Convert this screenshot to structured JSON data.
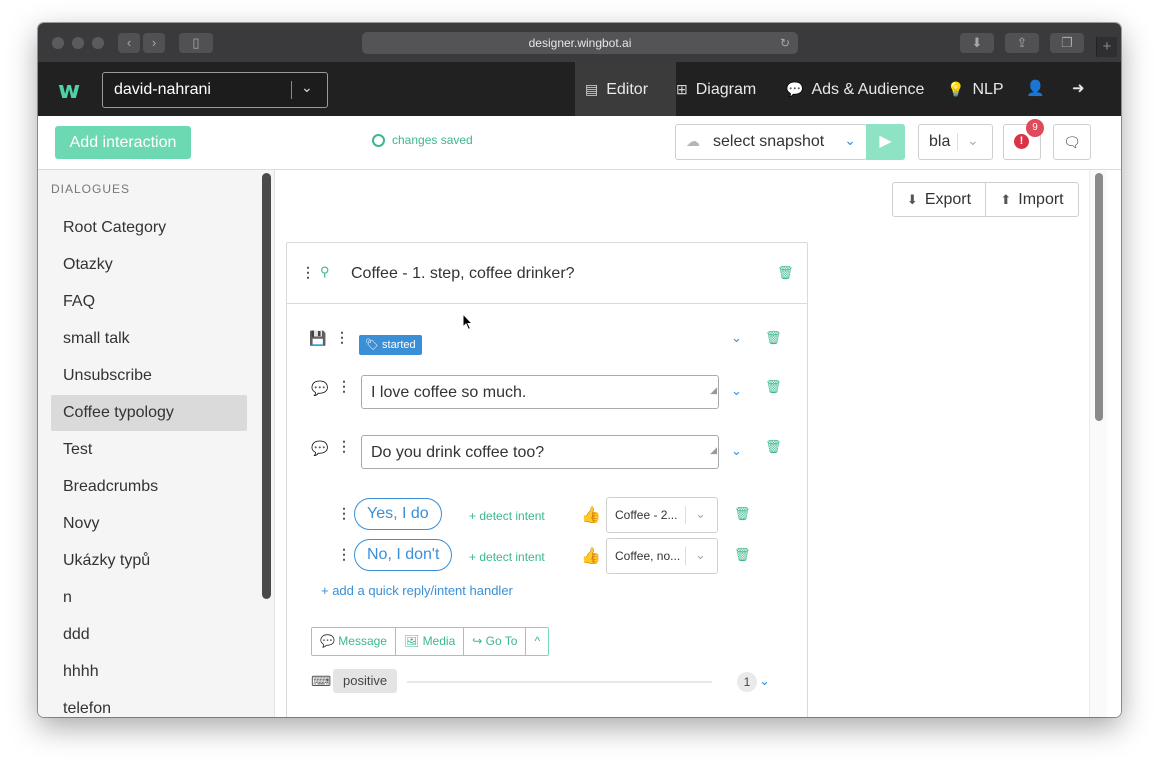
{
  "browser": {
    "url": "designer.wingbot.ai",
    "nav_back": "‹",
    "nav_forward": "›",
    "new_tab": "+"
  },
  "navbar": {
    "logo": "w",
    "bot_name": "david-nahrani",
    "items": [
      {
        "label": "Editor",
        "icon": "editor-icon"
      },
      {
        "label": "Diagram",
        "icon": "sitemap-icon"
      },
      {
        "label": "Ads & Audience",
        "icon": "comment-icon"
      },
      {
        "label": "NLP",
        "icon": "lightbulb-icon"
      }
    ]
  },
  "toolbar": {
    "add_interaction": "Add interaction",
    "status": "changes saved",
    "snapshot_placeholder": "select snapshot",
    "env_value": "bla",
    "alert_count": "9"
  },
  "sidebar": {
    "heading": "DIALOGUES",
    "items": [
      {
        "label": "Root Category"
      },
      {
        "label": "Otazky"
      },
      {
        "label": "FAQ"
      },
      {
        "label": "small talk"
      },
      {
        "label": "Unsubscribe"
      },
      {
        "label": "Coffee typology",
        "active": true
      },
      {
        "label": "Test"
      },
      {
        "label": "Breadcrumbs"
      },
      {
        "label": "Novy"
      },
      {
        "label": "Ukázky typů"
      },
      {
        "label": "n"
      },
      {
        "label": "ddd"
      },
      {
        "label": "hhhh"
      },
      {
        "label": "telefon"
      }
    ]
  },
  "main": {
    "export_label": "Export",
    "import_label": "Import",
    "interaction": {
      "title": "Coffee - 1. step, coffee drinker?",
      "tag": "started",
      "messages": [
        {
          "text": "I love coffee so much."
        },
        {
          "text": "Do you drink coffee too?"
        }
      ],
      "quick_replies": [
        {
          "label": "Yes, I do",
          "detect": "+ detect intent",
          "target": "Coffee - 2..."
        },
        {
          "label": "No, I don't",
          "detect": "+ detect intent",
          "target": "Coffee, no..."
        }
      ],
      "add_quick_reply": "+ add a quick reply/intent handler",
      "buttons": {
        "message": "Message",
        "media": "Media",
        "goto": "Go To",
        "more": "^"
      },
      "intent_pill": "positive",
      "intent_count": "1"
    }
  },
  "colors": {
    "brand_green": "#3db88a",
    "accent_blue": "#3a8fd6",
    "navbar_bg": "#212121",
    "alert_red": "#d93346"
  }
}
